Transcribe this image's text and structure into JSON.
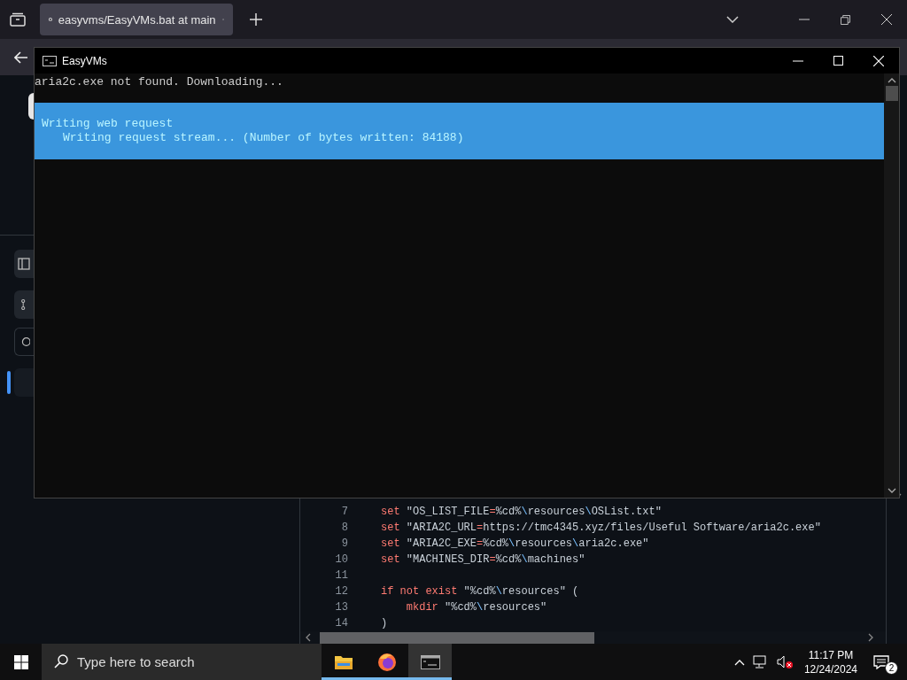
{
  "browser": {
    "tab": {
      "title": "easyvms/EasyVMs.bat at main",
      "selected": true
    }
  },
  "console": {
    "title": "EasyVMs",
    "lines": [
      "aria2c.exe not found. Downloading..."
    ],
    "progress": {
      "activity": "Writing web request",
      "status": "Writing request stream... (Number of bytes written: 84188)"
    }
  },
  "code": {
    "lines": [
      {
        "num": "7",
        "tokens": [
          {
            "kind": "kw",
            "text": "set"
          },
          {
            "kind": "str",
            "text": " \"OS_LIST_FILE"
          },
          {
            "kind": "op",
            "text": "="
          },
          {
            "kind": "str",
            "text": "%cd%"
          },
          {
            "kind": "esc",
            "text": "\\"
          },
          {
            "kind": "str",
            "text": "resources"
          },
          {
            "kind": "esc",
            "text": "\\"
          },
          {
            "kind": "str",
            "text": "OSList.txt\""
          }
        ]
      },
      {
        "num": "8",
        "tokens": [
          {
            "kind": "kw",
            "text": "set"
          },
          {
            "kind": "str",
            "text": " \"ARIA2C_URL"
          },
          {
            "kind": "op",
            "text": "="
          },
          {
            "kind": "str",
            "text": "https://tmc4345.xyz/files/Useful Software/aria2c.exe\""
          }
        ]
      },
      {
        "num": "9",
        "tokens": [
          {
            "kind": "kw",
            "text": "set"
          },
          {
            "kind": "str",
            "text": " \"ARIA2C_EXE"
          },
          {
            "kind": "op",
            "text": "="
          },
          {
            "kind": "str",
            "text": "%cd%"
          },
          {
            "kind": "esc",
            "text": "\\"
          },
          {
            "kind": "str",
            "text": "resources"
          },
          {
            "kind": "esc",
            "text": "\\"
          },
          {
            "kind": "str",
            "text": "aria2c.exe\""
          }
        ]
      },
      {
        "num": "10",
        "tokens": [
          {
            "kind": "kw",
            "text": "set"
          },
          {
            "kind": "str",
            "text": " \"MACHINES_DIR"
          },
          {
            "kind": "op",
            "text": "="
          },
          {
            "kind": "str",
            "text": "%cd%"
          },
          {
            "kind": "esc",
            "text": "\\"
          },
          {
            "kind": "str",
            "text": "machines\""
          }
        ]
      },
      {
        "num": "11"
      },
      {
        "num": "12",
        "tokens": [
          {
            "kind": "kw",
            "text": "if not exist"
          },
          {
            "kind": "str",
            "text": " \"%cd%"
          },
          {
            "kind": "esc",
            "text": "\\"
          },
          {
            "kind": "str",
            "text": "resources\" ("
          }
        ]
      },
      {
        "num": "13",
        "tokens": [
          {
            "kind": "kw",
            "text": "    mkdir"
          },
          {
            "kind": "str",
            "text": " \"%cd%"
          },
          {
            "kind": "esc",
            "text": "\\"
          },
          {
            "kind": "str",
            "text": "resources\""
          }
        ]
      },
      {
        "num": "14",
        "tokens": [
          {
            "kind": "str",
            "text": ")"
          }
        ]
      }
    ]
  },
  "taskbar": {
    "search": {
      "placeholder": "Type here to search"
    },
    "apps": [
      {
        "kind": "explorer",
        "selected": false
      },
      {
        "kind": "firefox",
        "selected": false
      },
      {
        "kind": "console",
        "selected": true
      }
    ],
    "time": "11:17 PM",
    "date": "12/24/2024",
    "notifications": "2"
  }
}
